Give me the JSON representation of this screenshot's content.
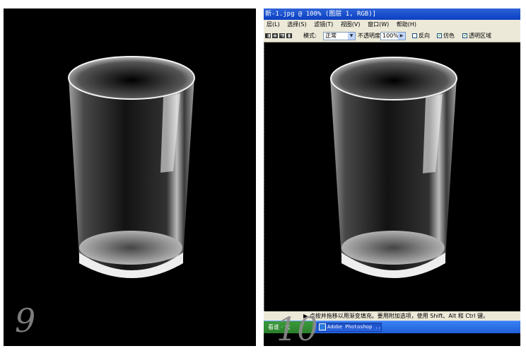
{
  "left_panel": {
    "step_number": "9"
  },
  "photoshop": {
    "title": "新-1.jpg @ 100% (图层 1, RGB)]",
    "menu": [
      "层(L)",
      "选择(S)",
      "滤镜(T)",
      "视图(V)",
      "窗口(W)",
      "帮助(H)"
    ],
    "options": {
      "mode_label": "模式:",
      "mode_value": "正常",
      "opacity_label": "不透明度:",
      "opacity_value": "100%",
      "reverse_label": "反向",
      "dither_label": "仿色",
      "transparency_label": "透明区域",
      "reverse_checked": false,
      "dither_checked": true,
      "transparency_checked": true
    },
    "status_text": "▶ 点按并拖移以用渐变填充。要用附加选项，使用 Shift、Alt 和 Ctrl 键。",
    "taskbar": {
      "start_label": "看谁 · 大",
      "task_label": "Adobe Photoshop ..."
    },
    "step_number": "10"
  },
  "colors": {
    "background": "#000000",
    "xp_blue": "#0a3fc1",
    "chrome": "#ece9d8"
  }
}
